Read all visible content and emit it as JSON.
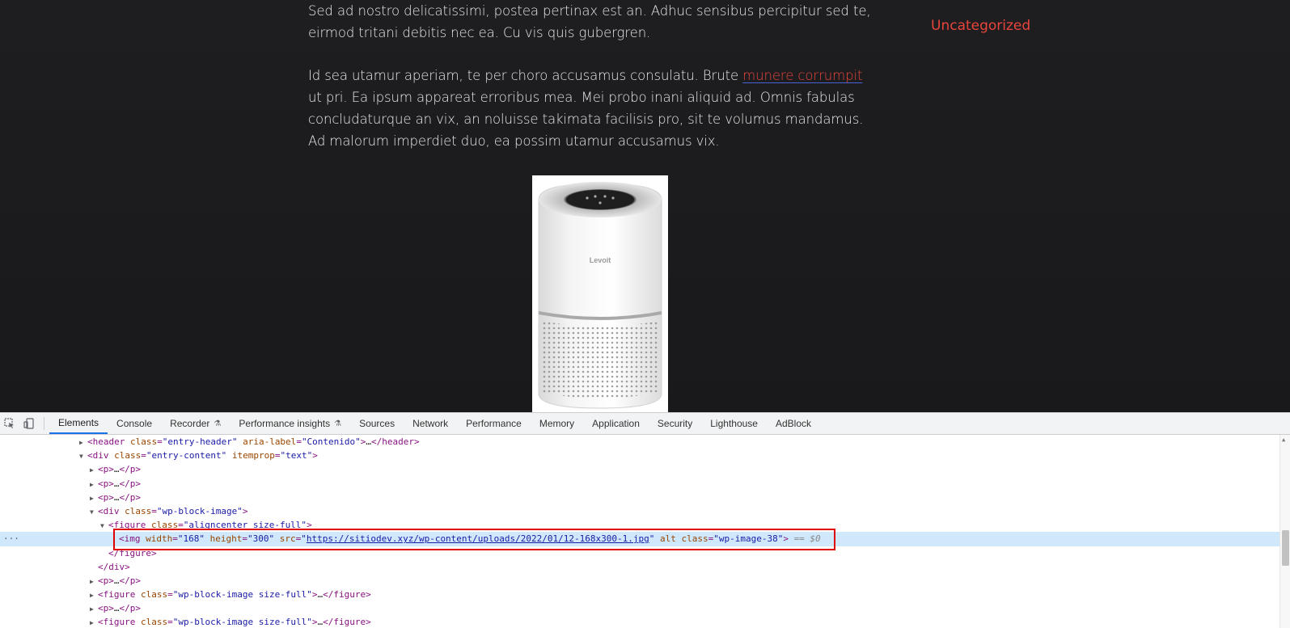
{
  "site": {
    "paragraph1": "Sed ad nostro delicatissimi, postea pertinax est an. Adhuc sensibus percipitur sed te, eirmod tritani debitis nec ea. Cu vis quis gubergren.",
    "paragraph2_before": "Id sea utamur aperiam, te per choro accusamus consulatu. Brute ",
    "paragraph2_link": "munere corrumpit",
    "paragraph2_after": " ut pri. Ea ipsum appareat erroribus mea. Mei probo inani aliquid ad. Omnis fabulas concludaturque an vix, an noluisse takimata facilisis pro, sit te volumus mandamus. Ad malorum imperdiet duo, ea possim utamur accusamus vix.",
    "sidebar_category": "Uncategorized",
    "product_brand": "Levoit"
  },
  "devtools": {
    "tabs": [
      {
        "label": "Elements",
        "active": true
      },
      {
        "label": "Console"
      },
      {
        "label": "Recorder",
        "beaker": true
      },
      {
        "label": "Performance insights",
        "beaker": true
      },
      {
        "label": "Sources"
      },
      {
        "label": "Network"
      },
      {
        "label": "Performance"
      },
      {
        "label": "Memory"
      },
      {
        "label": "Application"
      },
      {
        "label": "Security"
      },
      {
        "label": "Lighthouse"
      },
      {
        "label": "AdBlock"
      }
    ],
    "dom_lines": [
      {
        "indent": 1,
        "tri": "▶",
        "html": "<span class='tag'>&lt;header</span> <span class='attr-n'>class</span><span class='tag'>=</span><span class='attr-v'>\"entry-header\"</span> <span class='attr-n'>aria-label</span><span class='tag'>=</span><span class='attr-v'>\"Contenido\"</span><span class='tag'>&gt;</span>…<span class='tag'>&lt;/header&gt;</span>"
      },
      {
        "indent": 1,
        "tri": "▼",
        "html": "<span class='tag'>&lt;div</span> <span class='attr-n'>class</span><span class='tag'>=</span><span class='attr-v'>\"entry-content\"</span> <span class='attr-n'>itemprop</span><span class='tag'>=</span><span class='attr-v'>\"text\"</span><span class='tag'>&gt;</span>"
      },
      {
        "indent": 2,
        "tri": "▶",
        "html": "<span class='tag'>&lt;p&gt;</span>…<span class='tag'>&lt;/p&gt;</span>"
      },
      {
        "indent": 2,
        "tri": "▶",
        "html": "<span class='tag'>&lt;p&gt;</span>…<span class='tag'>&lt;/p&gt;</span>"
      },
      {
        "indent": 2,
        "tri": "▶",
        "html": "<span class='tag'>&lt;p&gt;</span>…<span class='tag'>&lt;/p&gt;</span>"
      },
      {
        "indent": 2,
        "tri": "▼",
        "html": "<span class='tag'>&lt;div</span> <span class='attr-n'>class</span><span class='tag'>=</span><span class='attr-v'>\"wp-block-image\"</span><span class='tag'>&gt;</span>"
      },
      {
        "indent": 3,
        "tri": "▼",
        "html": "<span class='tag'>&lt;figure</span> <span class='attr-n'>class</span><span class='tag'>=</span><span class='attr-v'>\"aligncenter size-full\"</span><span class='tag'>&gt;</span>"
      },
      {
        "indent": 4,
        "tri": "",
        "selected": true,
        "html": "<span class='tag'>&lt;img</span> <span class='attr-n'>width</span><span class='tag'>=</span><span class='attr-v'>\"168\"</span> <span class='attr-n'>height</span><span class='tag'>=</span><span class='attr-v'>\"300\"</span> <span class='attr-n'>src</span><span class='tag'>=</span><span class='attr-v'>\"</span><span class='link'>https://sitiodev.xyz/wp-content/uploads/2022/01/12-168x300-1.jpg</span><span class='attr-v'>\"</span> <span class='attr-n'>alt</span> <span class='attr-n'>class</span><span class='tag'>=</span><span class='attr-v'>\"wp-image-38\"</span><span class='tag'>&gt;</span> <span class='eq'>== $0</span>"
      },
      {
        "indent": 3,
        "tri": "",
        "html": "<span class='tag'>&lt;/figure&gt;</span>"
      },
      {
        "indent": 2,
        "tri": "",
        "html": "<span class='tag'>&lt;/div&gt;</span>"
      },
      {
        "indent": 2,
        "tri": "▶",
        "html": "<span class='tag'>&lt;p&gt;</span>…<span class='tag'>&lt;/p&gt;</span>"
      },
      {
        "indent": 2,
        "tri": "▶",
        "html": "<span class='tag'>&lt;figure</span> <span class='attr-n'>class</span><span class='tag'>=</span><span class='attr-v'>\"wp-block-image size-full\"</span><span class='tag'>&gt;</span>…<span class='tag'>&lt;/figure&gt;</span>"
      },
      {
        "indent": 2,
        "tri": "▶",
        "html": "<span class='tag'>&lt;p&gt;</span>…<span class='tag'>&lt;/p&gt;</span>"
      },
      {
        "indent": 2,
        "tri": "▶",
        "html": "<span class='tag'>&lt;figure</span> <span class='attr-n'>class</span><span class='tag'>=</span><span class='attr-v'>\"wp-block-image size-full\"</span><span class='tag'>&gt;</span>…<span class='tag'>&lt;/figure&gt;</span>"
      }
    ],
    "selected_ellipsis": "···",
    "colors": {
      "accent": "#1a73e8",
      "highlight_box": "#e00000",
      "link_red": "#e8453c"
    }
  }
}
